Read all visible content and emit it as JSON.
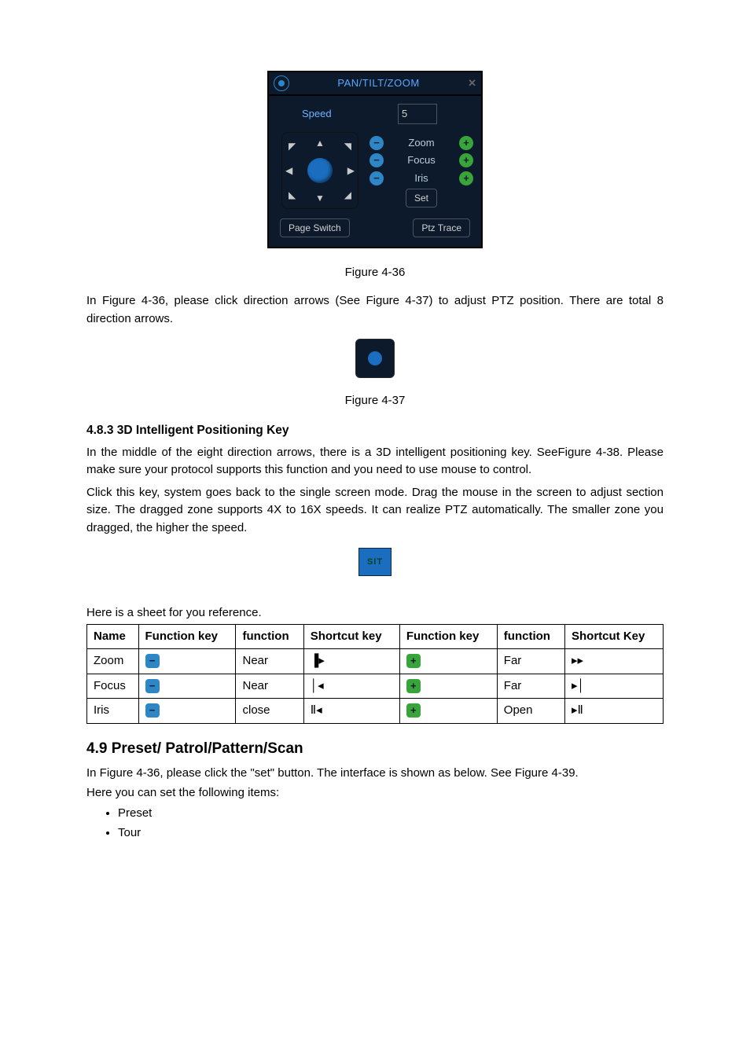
{
  "ptz": {
    "title": "PAN/TILT/ZOOM",
    "speed_label": "Speed",
    "speed_value": "5",
    "rows": [
      {
        "label": "Zoom"
      },
      {
        "label": "Focus"
      },
      {
        "label": "Iris"
      }
    ],
    "set_btn": "Set",
    "page_switch_btn": "Page Switch",
    "ptz_trace_btn": "Ptz Trace",
    "sit_label": "SIT"
  },
  "captions": {
    "fig36": "Figure 4-36",
    "fig37": "Figure 4-37"
  },
  "para1": "In Figure 4-36, please click direction arrows (See Figure 4-37) to adjust PTZ position. There are total 8 direction arrows.",
  "section_483": "4.8.3 3D Intelligent Positioning Key",
  "para2a": "In the middle of the eight direction arrows, there is a 3D intelligent positioning key. SeeFigure 4-38. Please make sure your protocol supports this function and you need to use mouse to control.",
  "para2b": "Click this key, system goes back to the single screen mode. Drag the mouse in the screen to adjust section size.   The dragged zone supports 4X to 16X speeds. It can realize PTZ automatically. The smaller zone you dragged, the higher the speed.",
  "sheet_intro": "Here is a sheet for you reference.",
  "table": {
    "headers": [
      "Name",
      "Function key",
      "function",
      "Shortcut key",
      "Function key",
      "function",
      "Shortcut Key"
    ],
    "rows": [
      {
        "name": "Zoom",
        "func1": "Near",
        "sk1": "▐▸",
        "func2": "Far",
        "sk2": "▸▸"
      },
      {
        "name": "Focus",
        "func1": "Near",
        "sk1": "│◂",
        "func2": "Far",
        "sk2": "▸│"
      },
      {
        "name": "Iris",
        "func1": "close",
        "sk1": "Ⅱ◂",
        "func2": "Open",
        "sk2": "▸Ⅱ"
      }
    ]
  },
  "section_49": "4.9  Preset/ Patrol/Pattern/Scan",
  "para3": "In Figure 4-36, please click the \"set\" button. The interface is shown as below. See Figure 4-39.",
  "para4": "Here you can set the following items:",
  "bullets": [
    "Preset",
    "Tour"
  ]
}
